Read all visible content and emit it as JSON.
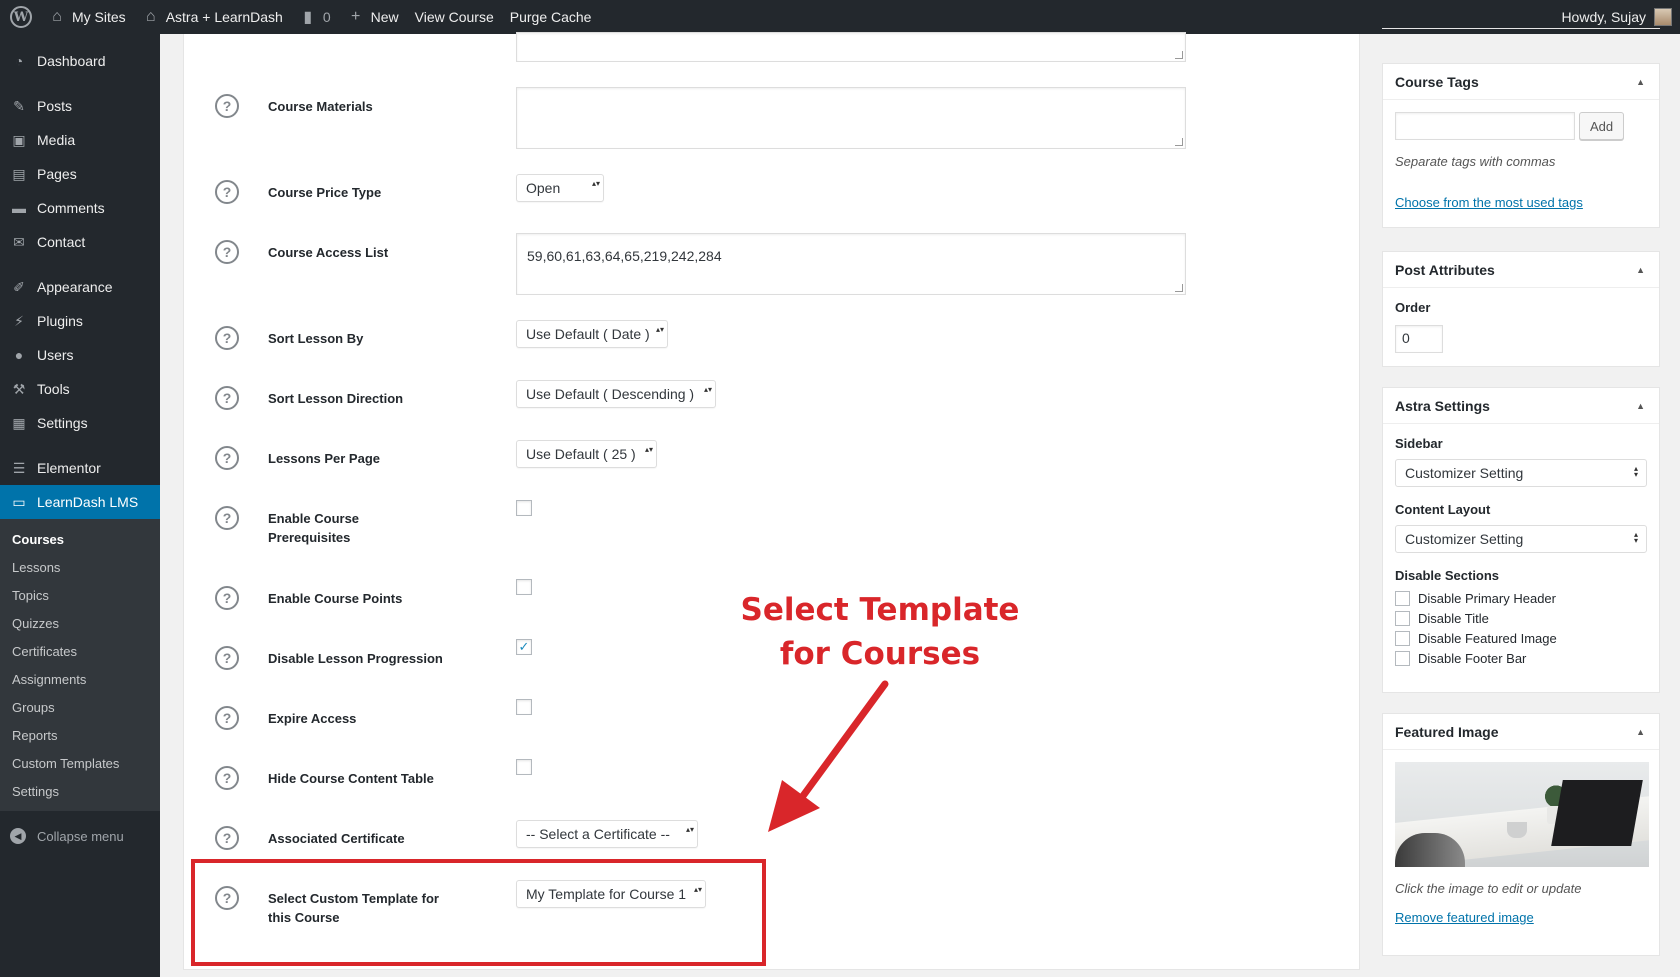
{
  "admin_bar": {
    "my_sites": "My Sites",
    "site_name": "Astra + LearnDash",
    "comments_count": "0",
    "new": "New",
    "view_course": "View Course",
    "purge_cache": "Purge Cache",
    "howdy": "Howdy, Sujay"
  },
  "sidebar": {
    "items": [
      {
        "label": "Dashboard",
        "icon": "dashboard-icon"
      },
      {
        "label": "Posts",
        "icon": "pin-icon"
      },
      {
        "label": "Media",
        "icon": "media-icon"
      },
      {
        "label": "Pages",
        "icon": "pages-icon"
      },
      {
        "label": "Comments",
        "icon": "comment-icon"
      },
      {
        "label": "Contact",
        "icon": "mail-icon"
      },
      {
        "label": "Appearance",
        "icon": "brush-icon"
      },
      {
        "label": "Plugins",
        "icon": "plug-icon"
      },
      {
        "label": "Users",
        "icon": "user-icon"
      },
      {
        "label": "Tools",
        "icon": "wrench-icon"
      },
      {
        "label": "Settings",
        "icon": "sliders-icon"
      },
      {
        "label": "Elementor",
        "icon": "elementor-icon"
      },
      {
        "label": "LearnDash LMS",
        "icon": "monitor-icon"
      }
    ],
    "submenu": [
      "Courses",
      "Lessons",
      "Topics",
      "Quizzes",
      "Certificates",
      "Assignments",
      "Groups",
      "Reports",
      "Custom Templates",
      "Settings"
    ],
    "collapse": "Collapse menu"
  },
  "course_settings": {
    "materials_label": "Course Materials",
    "price_type_label": "Course Price Type",
    "price_type_value": "Open",
    "access_list_label": "Course Access List",
    "access_list_value": "59,60,61,63,64,65,219,242,284",
    "sort_by_label": "Sort Lesson By",
    "sort_by_value": "Use Default ( Date )",
    "sort_dir_label": "Sort Lesson Direction",
    "sort_dir_value": "Use Default ( Descending )",
    "per_page_label": "Lessons Per Page",
    "per_page_value": "Use Default ( 25 )",
    "prereq_label": "Enable Course Prerequisites",
    "points_label": "Enable Course Points",
    "disable_progression_label": "Disable Lesson Progression",
    "disable_progression_checked": true,
    "expire_label": "Expire Access",
    "hide_table_label": "Hide Course Content Table",
    "certificate_label": "Associated Certificate",
    "certificate_value": "-- Select a Certificate --",
    "template_label": "Select Custom Template for this Course",
    "template_value": "My Template for Course 1"
  },
  "annotation": {
    "line1": "Select Template",
    "line2": "for Courses",
    "color": "#d9262a"
  },
  "course_tags": {
    "title": "Course Tags",
    "add_button": "Add",
    "hint": "Separate tags with commas",
    "choose_link": "Choose from the most used tags"
  },
  "post_attributes": {
    "title": "Post Attributes",
    "order_label": "Order",
    "order_value": "0"
  },
  "astra_settings": {
    "title": "Astra Settings",
    "sidebar_label": "Sidebar",
    "sidebar_value": "Customizer Setting",
    "content_layout_label": "Content Layout",
    "content_layout_value": "Customizer Setting",
    "disable_sections_label": "Disable Sections",
    "options": [
      "Disable Primary Header",
      "Disable Title",
      "Disable Featured Image",
      "Disable Footer Bar"
    ]
  },
  "featured_image": {
    "title": "Featured Image",
    "caption": "Click the image to edit or update",
    "remove_link": "Remove featured image"
  },
  "colors": {
    "admin_bg": "#23282d",
    "accent": "#0073aa",
    "highlight": "#d9262a"
  }
}
